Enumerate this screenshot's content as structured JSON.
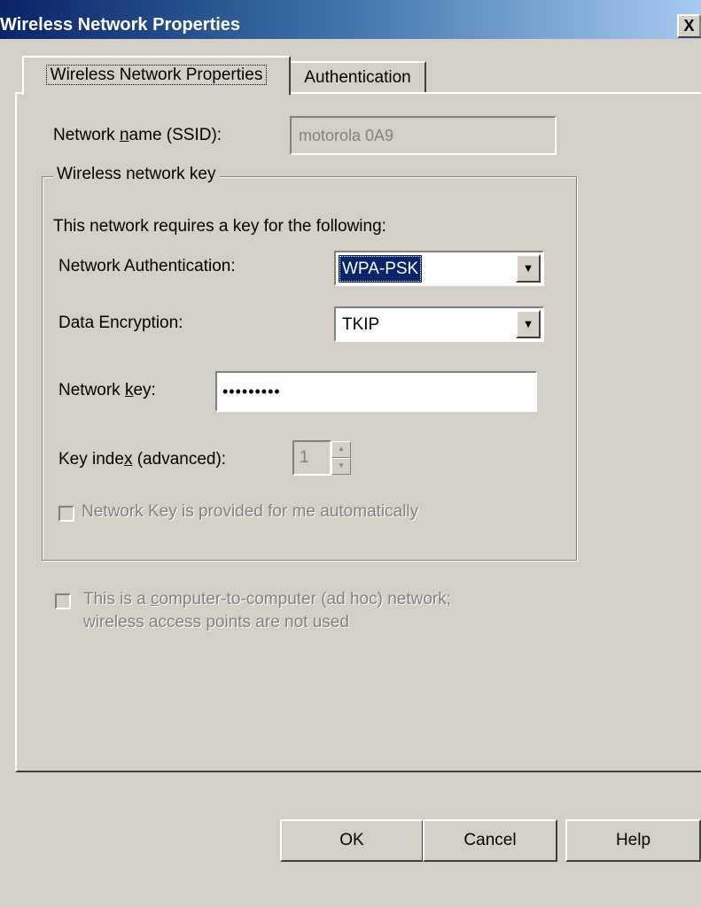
{
  "window": {
    "title": "Wireless Network Properties",
    "close_label": "X"
  },
  "tabs": [
    {
      "label": "Wireless Network Properties",
      "active": true
    },
    {
      "label": "Authentication",
      "active": false
    }
  ],
  "ssid": {
    "label_pre": "Network ",
    "label_key": "n",
    "label_post": "ame (SSID):",
    "value": "motorola 0A9"
  },
  "key_group": {
    "legend": "Wireless network key",
    "intro": "This network requires a key for the following:",
    "auth_label": "Network Authentication:",
    "auth_value": "WPA-PSK",
    "enc_label": "Data Encryption:",
    "enc_value": "TKIP",
    "netkey_label_pre": "Network ",
    "netkey_label_key": "k",
    "netkey_label_post": "ey:",
    "netkey_value": "•••••••••",
    "keyidx_label_pre": "Key inde",
    "keyidx_label_key": "x",
    "keyidx_label_post": " (advanced):",
    "keyidx_value": "1",
    "auto_key_label": "Network Key is provided for me automatically"
  },
  "adhoc": {
    "line1_pre": "This is a ",
    "line1_key": "c",
    "line1_post": "omputer-to-computer (ad hoc) network;",
    "line2": "wireless access points are not used"
  },
  "buttons": {
    "ok": "OK",
    "cancel": "Cancel",
    "help": "Help"
  }
}
